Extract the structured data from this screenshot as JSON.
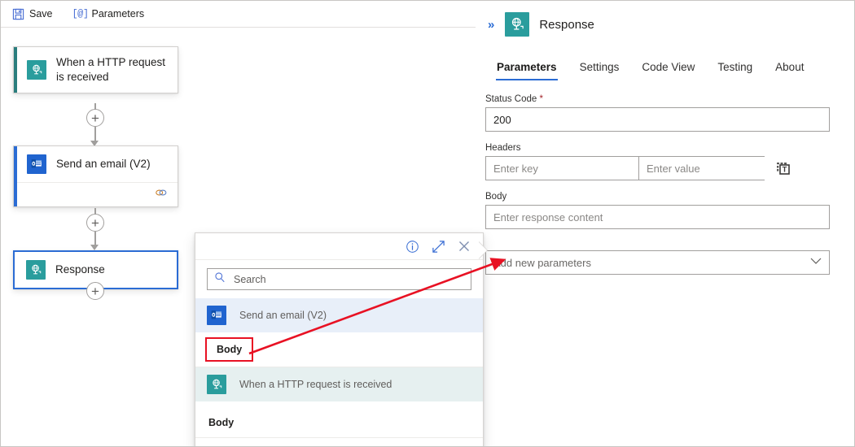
{
  "toolbar": {
    "save_label": "Save",
    "save_icon": "save-floppy-icon",
    "parameters_label": "Parameters",
    "parameters_icon": "at-bracket-icon"
  },
  "canvas": {
    "nodes": [
      {
        "id": "http-trigger",
        "title": "When a HTTP request is received",
        "icon": "http-request-globe-icon",
        "icon_color": "#2a9d9d",
        "accent_color": "#2a7d7d",
        "selected": false,
        "has_footer": false
      },
      {
        "id": "send-email",
        "title": "Send an email (V2)",
        "icon": "outlook-email-icon",
        "icon_color": "#2064cf",
        "accent_color": "#2b6cd4",
        "selected": false,
        "has_footer": true,
        "footer_icon": "connection-link-icon"
      },
      {
        "id": "response",
        "title": "Response",
        "icon": "http-response-globe-icon",
        "icon_color": "#2a9d9d",
        "accent_color": "#2b6cd4",
        "selected": true,
        "has_footer": false
      }
    ],
    "add_button_label": "+",
    "add_button_icon": "plus-icon"
  },
  "panel": {
    "collapse_icon": "chevron-double-right-icon",
    "title": "Response",
    "title_icon": "http-response-globe-icon",
    "tabs": [
      {
        "label": "Parameters",
        "active": true
      },
      {
        "label": "Settings",
        "active": false
      },
      {
        "label": "Code View",
        "active": false
      },
      {
        "label": "Testing",
        "active": false
      },
      {
        "label": "About",
        "active": false
      }
    ],
    "fields": {
      "status_code": {
        "label": "Status Code",
        "required_marker": "*",
        "value": "200"
      },
      "headers": {
        "label": "Headers",
        "key_placeholder": "Enter key",
        "value_placeholder": "Enter value",
        "token_icon": "insert-text-token-icon"
      },
      "body": {
        "label": "Body",
        "placeholder": "Enter response content"
      },
      "add_parameters": {
        "label": "Add new parameters",
        "chevron_icon": "chevron-down-icon"
      }
    }
  },
  "dynamic_content_picker": {
    "header_icons": [
      {
        "name": "info-icon",
        "glyph": "i"
      },
      {
        "name": "expand-diagonal-icon",
        "glyph": "arrow"
      },
      {
        "name": "close-icon",
        "glyph": "x"
      }
    ],
    "search": {
      "placeholder": "Search",
      "icon": "search-magnifier-icon"
    },
    "groups": [
      {
        "title": "Send an email (V2)",
        "icon": "outlook-email-icon",
        "header_style": "blue",
        "items": [
          {
            "label": "Body",
            "highlighted": true
          }
        ]
      },
      {
        "title": "When a HTTP request is received",
        "icon": "http-request-globe-icon",
        "header_style": "mint",
        "items": [
          {
            "label": "Body",
            "highlighted": false
          }
        ]
      }
    ]
  },
  "annotation": {
    "arrow_color": "#e81123",
    "highlight_box_color": "#e81123"
  }
}
